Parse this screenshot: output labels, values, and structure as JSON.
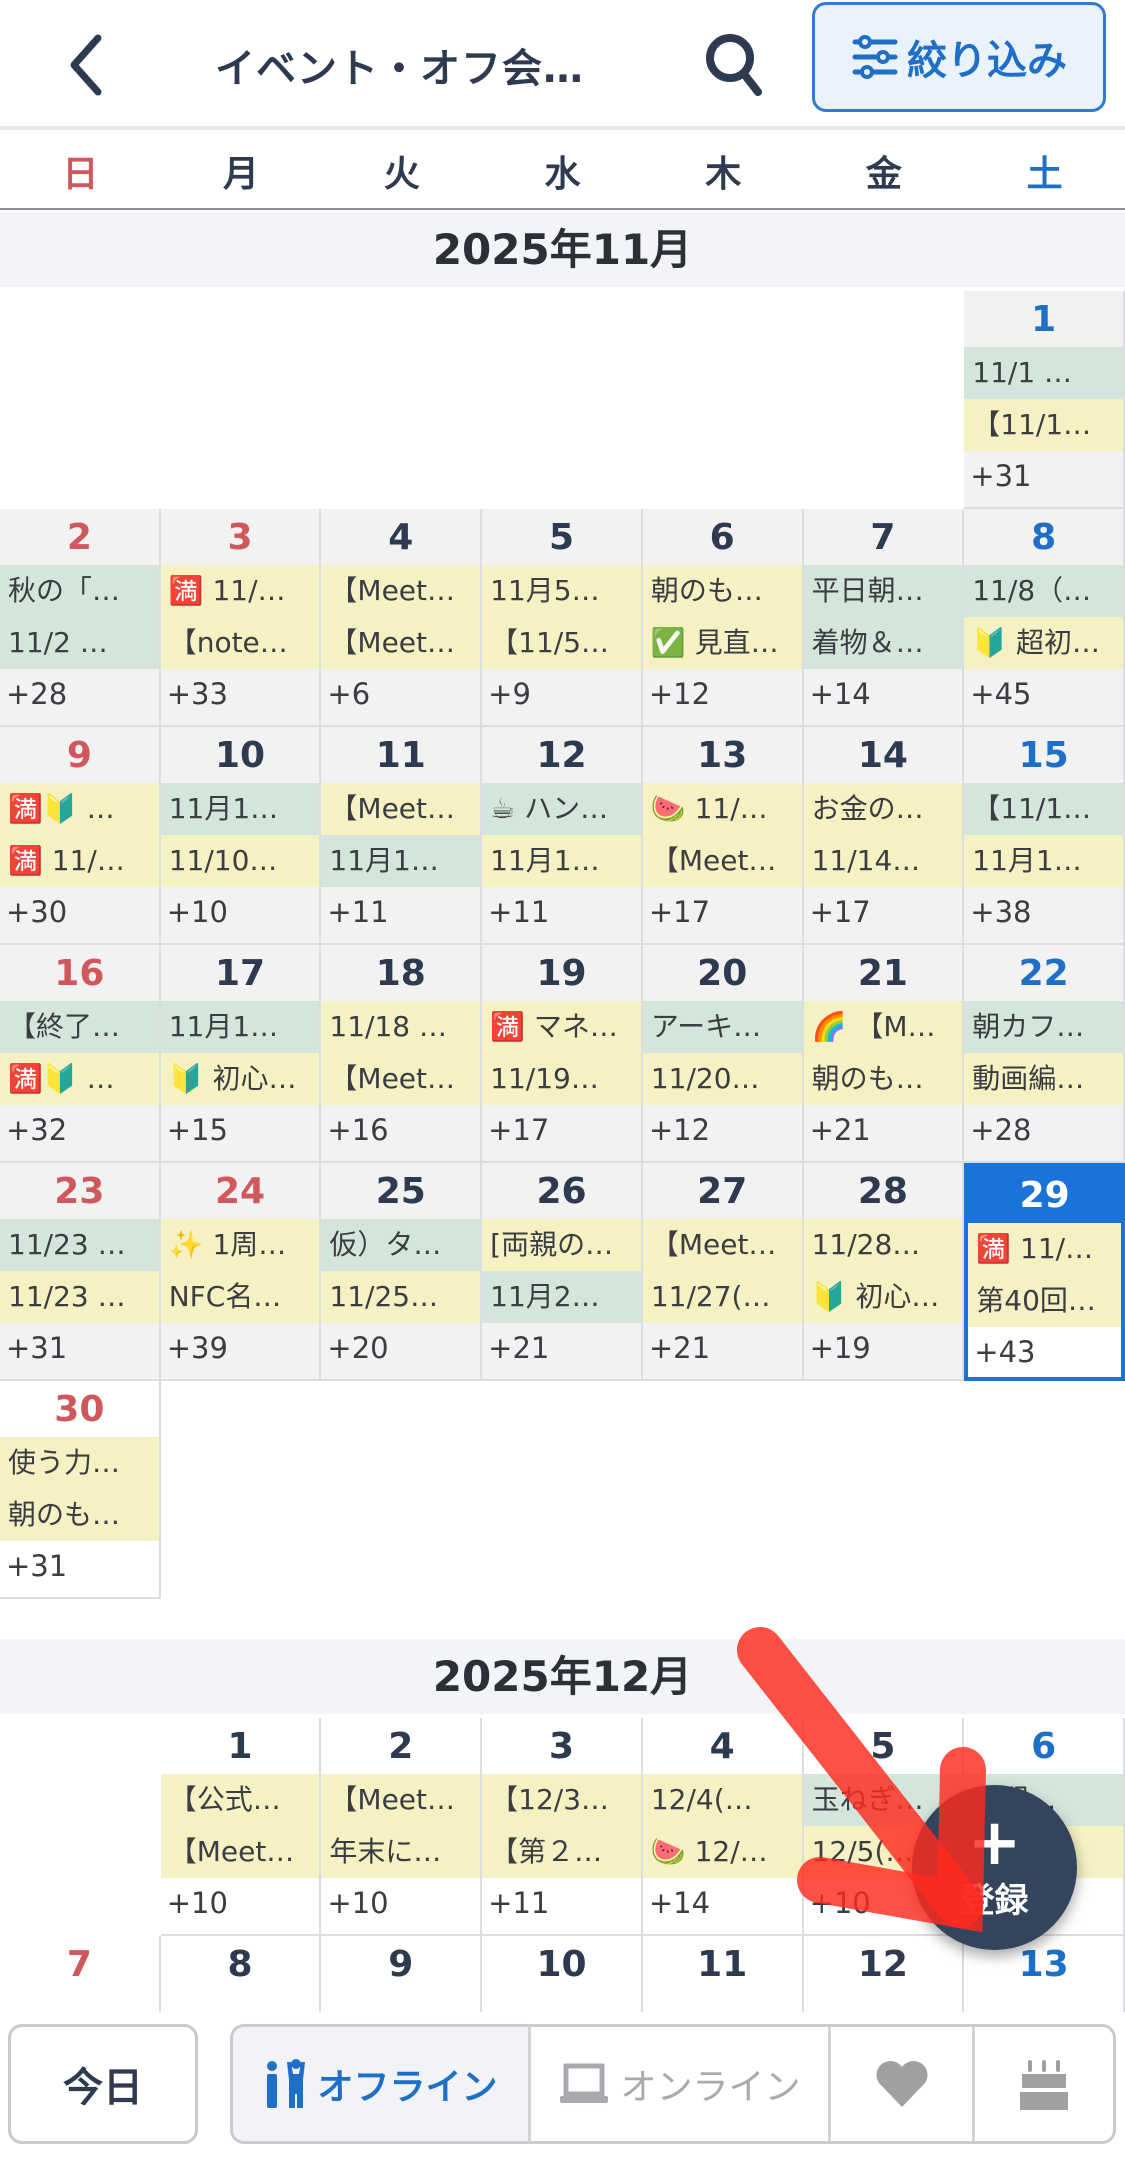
{
  "header": {
    "title": "イベント・オフ会…",
    "filter_label": "絞り込み"
  },
  "weekdays": [
    "日",
    "月",
    "火",
    "水",
    "木",
    "金",
    "土"
  ],
  "colors": {
    "accent": "#1f6fc6",
    "sunday": "#d0575b",
    "saturday": "#1f6fc6",
    "event_green": "#d4e6dc",
    "event_yellow": "#f6f1c3",
    "fab": "#34445c"
  },
  "months": [
    {
      "title": "2025年11月",
      "leading_blanks": 6,
      "days": [
        {
          "day": "1",
          "tone": "sat",
          "past": true,
          "events": [
            {
              "text": "11/1 …",
              "color": "green"
            },
            {
              "text": "【11/1…",
              "color": "yellow"
            }
          ],
          "more": "+31"
        },
        {
          "day": "2",
          "tone": "sun",
          "past": true,
          "events": [
            {
              "text": "秋の「…",
              "color": "green"
            },
            {
              "text": "11/2 …",
              "color": "green"
            }
          ],
          "more": "+28"
        },
        {
          "day": "3",
          "tone": "sun",
          "past": true,
          "events": [
            {
              "text": "🈵 11/…",
              "color": "yellow"
            },
            {
              "text": "【note…",
              "color": "yellow"
            }
          ],
          "more": "+33"
        },
        {
          "day": "4",
          "tone": "wd",
          "past": true,
          "events": [
            {
              "text": "【Meet…",
              "color": "yellow"
            },
            {
              "text": "【Meet…",
              "color": "yellow"
            }
          ],
          "more": "+6"
        },
        {
          "day": "5",
          "tone": "wd",
          "past": true,
          "events": [
            {
              "text": "11月5…",
              "color": "yellow"
            },
            {
              "text": "【11/5…",
              "color": "yellow"
            }
          ],
          "more": "+9"
        },
        {
          "day": "6",
          "tone": "wd",
          "past": true,
          "events": [
            {
              "text": "朝のも…",
              "color": "yellow"
            },
            {
              "text": "✅ 見直…",
              "color": "yellow"
            }
          ],
          "more": "+12"
        },
        {
          "day": "7",
          "tone": "wd",
          "past": true,
          "events": [
            {
              "text": "平日朝…",
              "color": "green"
            },
            {
              "text": "着物＆…",
              "color": "green"
            }
          ],
          "more": "+14"
        },
        {
          "day": "8",
          "tone": "sat",
          "past": true,
          "events": [
            {
              "text": "11/8（…",
              "color": "green"
            },
            {
              "text": "🔰 超初…",
              "color": "yellow"
            }
          ],
          "more": "+45"
        },
        {
          "day": "9",
          "tone": "sun",
          "past": true,
          "events": [
            {
              "text": "🈵🔰 …",
              "color": "yellow"
            },
            {
              "text": "🈵 11/…",
              "color": "yellow"
            }
          ],
          "more": "+30"
        },
        {
          "day": "10",
          "tone": "wd",
          "past": true,
          "events": [
            {
              "text": "11月1…",
              "color": "green"
            },
            {
              "text": "11/10…",
              "color": "yellow"
            }
          ],
          "more": "+10"
        },
        {
          "day": "11",
          "tone": "wd",
          "past": true,
          "events": [
            {
              "text": "【Meet…",
              "color": "yellow"
            },
            {
              "text": "11月1…",
              "color": "green"
            }
          ],
          "more": "+11"
        },
        {
          "day": "12",
          "tone": "wd",
          "past": true,
          "events": [
            {
              "text": "☕ ハン…",
              "color": "green"
            },
            {
              "text": "11月1…",
              "color": "yellow"
            }
          ],
          "more": "+11"
        },
        {
          "day": "13",
          "tone": "wd",
          "past": true,
          "events": [
            {
              "text": "🍉 11/…",
              "color": "yellow"
            },
            {
              "text": "【Meet…",
              "color": "yellow"
            }
          ],
          "more": "+17"
        },
        {
          "day": "14",
          "tone": "wd",
          "past": true,
          "events": [
            {
              "text": "お金の…",
              "color": "yellow"
            },
            {
              "text": "11/14…",
              "color": "yellow"
            }
          ],
          "more": "+17"
        },
        {
          "day": "15",
          "tone": "sat",
          "past": true,
          "events": [
            {
              "text": "【11/1…",
              "color": "green"
            },
            {
              "text": "11月1…",
              "color": "yellow"
            }
          ],
          "more": "+38"
        },
        {
          "day": "16",
          "tone": "sun",
          "past": true,
          "events": [
            {
              "text": "【終了…",
              "color": "green"
            },
            {
              "text": "🈵🔰 …",
              "color": "yellow"
            }
          ],
          "more": "+32"
        },
        {
          "day": "17",
          "tone": "wd",
          "past": true,
          "events": [
            {
              "text": "11月1…",
              "color": "green"
            },
            {
              "text": "🔰 初心…",
              "color": "yellow"
            }
          ],
          "more": "+15"
        },
        {
          "day": "18",
          "tone": "wd",
          "past": true,
          "events": [
            {
              "text": "11/18 …",
              "color": "yellow"
            },
            {
              "text": "【Meet…",
              "color": "yellow"
            }
          ],
          "more": "+16"
        },
        {
          "day": "19",
          "tone": "wd",
          "past": true,
          "events": [
            {
              "text": "🈵 マネ…",
              "color": "yellow"
            },
            {
              "text": "11/19…",
              "color": "yellow"
            }
          ],
          "more": "+17"
        },
        {
          "day": "20",
          "tone": "wd",
          "past": true,
          "events": [
            {
              "text": "アーキ…",
              "color": "green"
            },
            {
              "text": "11/20…",
              "color": "yellow"
            }
          ],
          "more": "+12"
        },
        {
          "day": "21",
          "tone": "wd",
          "past": true,
          "events": [
            {
              "text": "🌈 【M…",
              "color": "yellow"
            },
            {
              "text": "朝のも…",
              "color": "yellow"
            }
          ],
          "more": "+21"
        },
        {
          "day": "22",
          "tone": "sat",
          "past": true,
          "events": [
            {
              "text": "朝カフ…",
              "color": "green"
            },
            {
              "text": "動画編…",
              "color": "yellow"
            }
          ],
          "more": "+28"
        },
        {
          "day": "23",
          "tone": "sun",
          "past": true,
          "events": [
            {
              "text": "11/23 …",
              "color": "green"
            },
            {
              "text": "11/23 …",
              "color": "yellow"
            }
          ],
          "more": "+31"
        },
        {
          "day": "24",
          "tone": "sun",
          "past": true,
          "events": [
            {
              "text": "✨ 1周…",
              "color": "yellow"
            },
            {
              "text": "NFC名…",
              "color": "yellow"
            }
          ],
          "more": "+39"
        },
        {
          "day": "25",
          "tone": "wd",
          "past": true,
          "events": [
            {
              "text": "仮）タ…",
              "color": "green"
            },
            {
              "text": "11/25…",
              "color": "yellow"
            }
          ],
          "more": "+20"
        },
        {
          "day": "26",
          "tone": "wd",
          "past": true,
          "events": [
            {
              "text": "[両親の…",
              "color": "yellow"
            },
            {
              "text": "11月2…",
              "color": "green"
            }
          ],
          "more": "+21"
        },
        {
          "day": "27",
          "tone": "wd",
          "past": true,
          "events": [
            {
              "text": "【Meet…",
              "color": "yellow"
            },
            {
              "text": "11/27(…",
              "color": "yellow"
            }
          ],
          "more": "+21"
        },
        {
          "day": "28",
          "tone": "wd",
          "past": true,
          "events": [
            {
              "text": "11/28…",
              "color": "yellow"
            },
            {
              "text": "🔰 初心…",
              "color": "yellow"
            }
          ],
          "more": "+19"
        },
        {
          "day": "29",
          "tone": "sat",
          "today": true,
          "events": [
            {
              "text": "🈵 11/…",
              "color": "yellow"
            },
            {
              "text": "第40回…",
              "color": "yellow"
            }
          ],
          "more": "+43"
        },
        {
          "day": "30",
          "tone": "sun",
          "events": [
            {
              "text": "使う力…",
              "color": "yellow"
            },
            {
              "text": "朝のも…",
              "color": "yellow"
            }
          ],
          "more": "+31"
        }
      ]
    },
    {
      "title": "2025年12月",
      "leading_blanks": 1,
      "days": [
        {
          "day": "1",
          "tone": "wd",
          "events": [
            {
              "text": "【公式…",
              "color": "yellow"
            },
            {
              "text": "【Meet…",
              "color": "yellow"
            }
          ],
          "more": "+10"
        },
        {
          "day": "2",
          "tone": "wd",
          "events": [
            {
              "text": "【Meet…",
              "color": "yellow"
            },
            {
              "text": "年末に…",
              "color": "yellow"
            }
          ],
          "more": "+10"
        },
        {
          "day": "3",
          "tone": "wd",
          "events": [
            {
              "text": "【12/3…",
              "color": "yellow"
            },
            {
              "text": "【第２…",
              "color": "yellow"
            }
          ],
          "more": "+11"
        },
        {
          "day": "4",
          "tone": "wd",
          "events": [
            {
              "text": "12/4(…",
              "color": "yellow"
            },
            {
              "text": "🍉 12/…",
              "color": "yellow"
            }
          ],
          "more": "+14"
        },
        {
          "day": "5",
          "tone": "wd",
          "events": [
            {
              "text": "玉ねぎ…",
              "color": "green"
            },
            {
              "text": "12/5(…",
              "color": "yellow"
            }
          ],
          "more": "+10"
        },
        {
          "day": "6",
          "tone": "sat",
          "events": [
            {
              "text": "…駅…",
              "color": "green"
            },
            {
              "text": "…",
              "color": "yellow"
            }
          ],
          "more": ""
        },
        {
          "day": "7",
          "tone": "sun",
          "events": [],
          "more": ""
        },
        {
          "day": "8",
          "tone": "wd",
          "events": [],
          "more": ""
        },
        {
          "day": "9",
          "tone": "wd",
          "events": [],
          "more": ""
        },
        {
          "day": "10",
          "tone": "wd",
          "events": [],
          "more": ""
        },
        {
          "day": "11",
          "tone": "wd",
          "events": [],
          "more": ""
        },
        {
          "day": "12",
          "tone": "wd",
          "events": [],
          "more": ""
        },
        {
          "day": "13",
          "tone": "sat",
          "events": [],
          "more": ""
        }
      ]
    }
  ],
  "fab": {
    "plus": "+",
    "label": "登録"
  },
  "bottom": {
    "today_label": "今日",
    "offline_label": "オフライン",
    "online_label": "オンライン"
  }
}
